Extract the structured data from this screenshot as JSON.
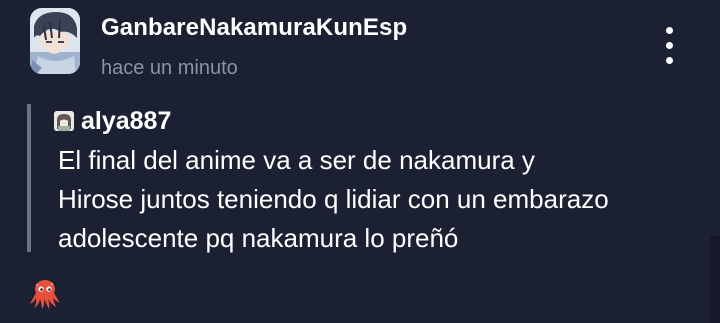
{
  "comment": {
    "author": "GanbareNakamuraKunEsp",
    "timestamp": "hace un minuto",
    "quoted": {
      "author": "alya887",
      "lines": [
        "El final del anime va a ser de nakamura y",
        "Hirose juntos teniendo q lidiar con un embarazo",
        "adolescente pq nakamura lo preñó"
      ]
    }
  },
  "icons": {
    "menu": "vertical-ellipsis",
    "reaction": "octopus"
  },
  "colors": {
    "background": "#1c2033",
    "text": "#ffffff",
    "muted": "#8c91a3",
    "quote_bar": "#6e7485",
    "octopus": "#e8503c"
  }
}
